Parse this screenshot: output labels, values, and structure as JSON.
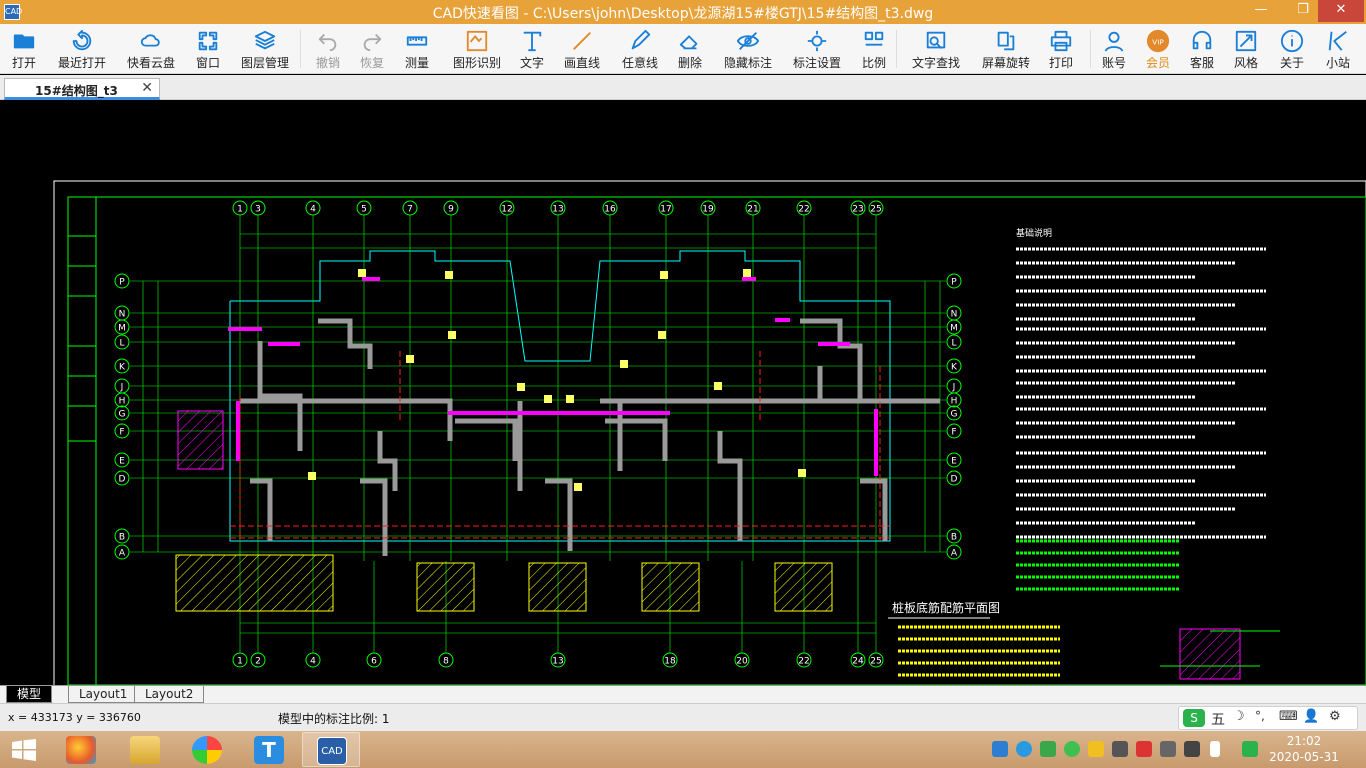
{
  "window": {
    "icon_text": "CAD",
    "title": "CAD快速看图 - C:\\Users\\john\\Desktop\\龙源湖15#楼GTJ\\15#结构图_t3.dwg",
    "buttons": {
      "minimize": "—",
      "maximize": "❐",
      "close": "✕"
    }
  },
  "toolbar": {
    "items": [
      {
        "id": "open",
        "label": "打开",
        "icon": "folder-icon",
        "color": "#1a7fd6"
      },
      {
        "id": "recent",
        "label": "最近打开",
        "icon": "history-icon",
        "color": "#1a7fd6"
      },
      {
        "id": "cloud",
        "label": "快看云盘",
        "icon": "cloud-icon",
        "color": "#1a7fd6"
      },
      {
        "id": "window",
        "label": "窗口",
        "icon": "window-icon",
        "color": "#1a7fd6"
      },
      {
        "id": "layers",
        "label": "图层管理",
        "icon": "layers-icon",
        "color": "#1a7fd6"
      },
      {
        "id": "undo",
        "label": "撤销",
        "icon": "undo-icon",
        "color": "#aaaaaa",
        "disabled": true
      },
      {
        "id": "redo",
        "label": "恢复",
        "icon": "redo-icon",
        "color": "#aaaaaa",
        "disabled": true
      },
      {
        "id": "measure",
        "label": "测量",
        "icon": "ruler-icon",
        "color": "#1a7fd6"
      },
      {
        "id": "shape",
        "label": "图形识别",
        "icon": "shape-icon",
        "color": "#e2892b"
      },
      {
        "id": "text",
        "label": "文字",
        "icon": "text-icon",
        "color": "#1a7fd6"
      },
      {
        "id": "line",
        "label": "画直线",
        "icon": "line-icon",
        "color": "#e2892b"
      },
      {
        "id": "freeline",
        "label": "任意线",
        "icon": "pen-icon",
        "color": "#1a7fd6"
      },
      {
        "id": "erase",
        "label": "删除",
        "icon": "eraser-icon",
        "color": "#1a7fd6"
      },
      {
        "id": "hide",
        "label": "隐藏标注",
        "icon": "eye-icon",
        "color": "#1a7fd6"
      },
      {
        "id": "markset",
        "label": "标注设置",
        "icon": "gear-icon",
        "color": "#1a7fd6"
      },
      {
        "id": "scale",
        "label": "比例",
        "icon": "scale-icon",
        "color": "#1a7fd6"
      },
      {
        "id": "find",
        "label": "文字查找",
        "icon": "find-text-icon",
        "color": "#1a7fd6"
      },
      {
        "id": "rotate",
        "label": "屏幕旋转",
        "icon": "rotate-icon",
        "color": "#1a7fd6"
      },
      {
        "id": "print",
        "label": "打印",
        "icon": "printer-icon",
        "color": "#1a7fd6"
      },
      {
        "id": "account",
        "label": "账号",
        "icon": "user-icon",
        "color": "#1a7fd6"
      },
      {
        "id": "vip",
        "label": "会员",
        "icon": "vip-icon",
        "color": "#e2892b",
        "vip": true
      },
      {
        "id": "service",
        "label": "客服",
        "icon": "headset-icon",
        "color": "#1a7fd6"
      },
      {
        "id": "style",
        "label": "风格",
        "icon": "style-icon",
        "color": "#1a7fd6"
      },
      {
        "id": "about",
        "label": "关于",
        "icon": "info-icon",
        "color": "#1a7fd6"
      },
      {
        "id": "station",
        "label": "小站",
        "icon": "k-logo-icon",
        "color": "#1a7fd6"
      }
    ]
  },
  "tabs": {
    "document": "15#结构图_t3",
    "close": "✕"
  },
  "drawing": {
    "plan_title": "桩板底筋配筋平面图",
    "notes_title": "基础说明",
    "top_axes": [
      "1",
      "3",
      "4",
      "5",
      "7",
      "9",
      "12",
      "13",
      "16",
      "17",
      "19",
      "21",
      "22",
      "23",
      "25"
    ],
    "bottom_axes": [
      "1",
      "2",
      "4",
      "6",
      "8",
      "13",
      "18",
      "20",
      "22",
      "24",
      "25"
    ],
    "side_axes": [
      "P",
      "N",
      "M",
      "L",
      "K",
      "J",
      "H",
      "G",
      "F",
      "E",
      "D",
      "B",
      "A"
    ]
  },
  "layout_tabs": [
    "模型",
    "Layout1",
    "Layout2"
  ],
  "status": {
    "coords": "x = 433173  y = 336760",
    "scale_text": "模型中的标注比例: 1",
    "ime_char": "五"
  },
  "taskbar": {
    "time": "21:02",
    "date": "2020-05-31"
  }
}
